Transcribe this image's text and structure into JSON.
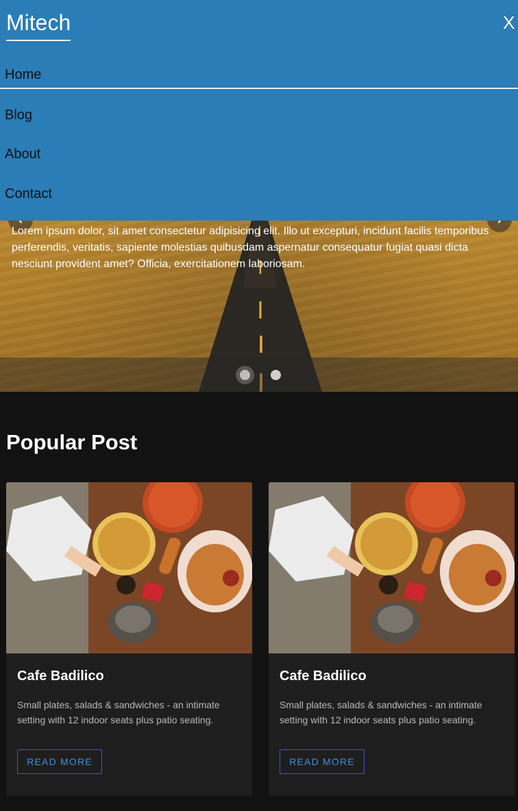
{
  "nav": {
    "brand": "Mitech",
    "close_label": "X",
    "items": [
      {
        "label": "Home"
      },
      {
        "label": "Blog"
      },
      {
        "label": "About"
      },
      {
        "label": "Contact"
      }
    ]
  },
  "hero": {
    "caption": "Lorem ipsum dolor, sit amet consectetur adipisicing elit. Illo ut excepturi, incidunt facilis temporibus perferendis, veritatis, sapiente molestias quibusdam aspernatur consequatur fugiat quasi dicta nesciunt provident amet? Officia, exercitationem laboriosam.",
    "prev_icon": "chevron-left-icon",
    "next_icon": "chevron-right-icon",
    "slides_total": 2,
    "active_slide": 1
  },
  "popular": {
    "title": "Popular Post",
    "cards": [
      {
        "title": "Cafe Badilico",
        "text": "Small plates, salads & sandwiches - an intimate setting with 12 indoor seats plus patio seating.",
        "button": "READ MORE"
      },
      {
        "title": "Cafe Badilico",
        "text": "Small plates, salads & sandwiches - an intimate setting with 12 indoor seats plus patio seating.",
        "button": "READ MORE"
      }
    ]
  },
  "colors": {
    "nav_bg": "#2a7db7",
    "page_bg": "#121212",
    "card_bg": "#1e1e1e",
    "button_text": "#3f8fdd"
  }
}
